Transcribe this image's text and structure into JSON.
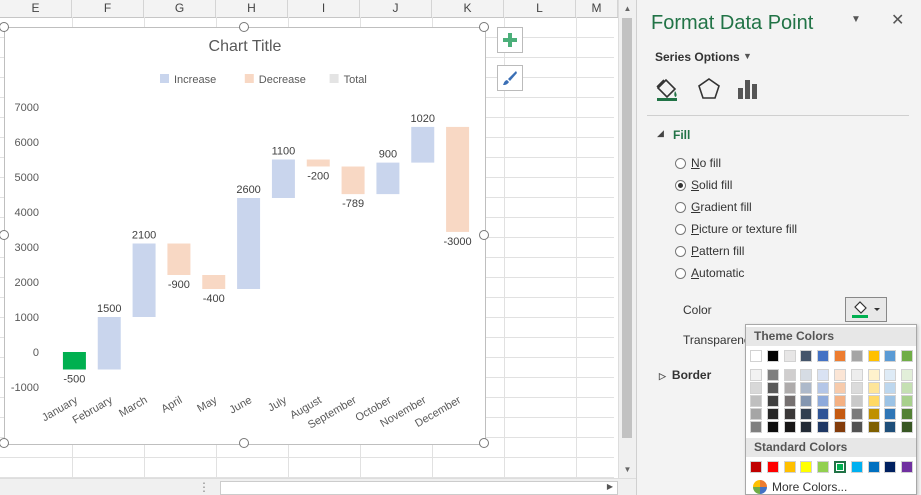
{
  "sheet": {
    "columns": [
      "E",
      "F",
      "G",
      "H",
      "I",
      "J",
      "K",
      "L",
      "M"
    ]
  },
  "chart_data": {
    "type": "bar",
    "title": "Chart Title",
    "categories": [
      "January",
      "February",
      "March",
      "April",
      "May",
      "June",
      "July",
      "August",
      "September",
      "October",
      "November",
      "December"
    ],
    "series": [
      {
        "name": "Increase",
        "color": "#c9d5ed"
      },
      {
        "name": "Decrease",
        "color": "#f8d8c4"
      },
      {
        "name": "Total",
        "color": "#e4e4e4"
      }
    ],
    "values": [
      -500,
      1500,
      2100,
      -900,
      -400,
      2600,
      1100,
      -200,
      -789,
      900,
      1020,
      -3000
    ],
    "data_labels": [
      "-500",
      "1500",
      "2100",
      "-900",
      "-400",
      "2600",
      "1100",
      "-200",
      "-789",
      "900",
      "1020",
      "-3000"
    ],
    "highlight": {
      "index": 0,
      "color": "#00b050"
    },
    "ylim": [
      -1000,
      7000
    ],
    "yticks": [
      -1000,
      0,
      1000,
      2000,
      3000,
      4000,
      5000,
      6000,
      7000
    ],
    "legend_position": "top",
    "grid": false
  },
  "pane": {
    "title": "Format Data Point",
    "series_options": "Series Options",
    "icons": [
      "paint-bucket-icon",
      "pentagon-icon",
      "bar-chart-icon"
    ],
    "fill_header": "Fill",
    "fill_options": [
      {
        "label": "No fill",
        "selected": false
      },
      {
        "label": "Solid fill",
        "selected": true
      },
      {
        "label": "Gradient fill",
        "selected": false
      },
      {
        "label": "Picture or texture fill",
        "selected": false
      },
      {
        "label": "Pattern fill",
        "selected": false
      },
      {
        "label": "Automatic",
        "selected": false
      }
    ],
    "color_label": "Color",
    "transparency_label": "Transparency",
    "border_header": "Border"
  },
  "dropdown": {
    "theme_header": "Theme Colors",
    "standard_header": "Standard Colors",
    "more_colors": "More Colors...",
    "theme_top": [
      "#ffffff",
      "#000000",
      "#e7e6e6",
      "#44546a",
      "#4472c4",
      "#ed7d31",
      "#a5a5a5",
      "#ffc000",
      "#5b9bd5",
      "#70ad47"
    ],
    "theme_shades": [
      [
        "#f2f2f2",
        "#7f7f7f",
        "#d0cece",
        "#d6dce4",
        "#d9e2f3",
        "#fbe5d5",
        "#ededed",
        "#fff2cc",
        "#deebf6",
        "#e2efd9"
      ],
      [
        "#d8d8d8",
        "#595959",
        "#aeabab",
        "#adb9ca",
        "#b4c6e7",
        "#f7cbac",
        "#dbdbdb",
        "#fee599",
        "#bdd7ee",
        "#c5e0b3"
      ],
      [
        "#bfbfbf",
        "#3f3f3f",
        "#757070",
        "#8496b0",
        "#8eaadb",
        "#f4b183",
        "#c9c9c9",
        "#ffd965",
        "#9cc3e5",
        "#a8d08d"
      ],
      [
        "#a5a5a5",
        "#262626",
        "#3a3838",
        "#323f4f",
        "#2f5496",
        "#c55a11",
        "#7b7b7b",
        "#bf9000",
        "#2e75b5",
        "#538135"
      ],
      [
        "#7f7f7f",
        "#0c0c0c",
        "#171616",
        "#222a35",
        "#1f3864",
        "#833c0b",
        "#525252",
        "#7f6000",
        "#1e4e79",
        "#375623"
      ]
    ],
    "standard": [
      "#c00000",
      "#ff0000",
      "#ffc000",
      "#ffff00",
      "#92d050",
      "#00b050",
      "#00b0f0",
      "#0070c0",
      "#002060",
      "#7030a0"
    ],
    "selected_standard_index": 5
  }
}
